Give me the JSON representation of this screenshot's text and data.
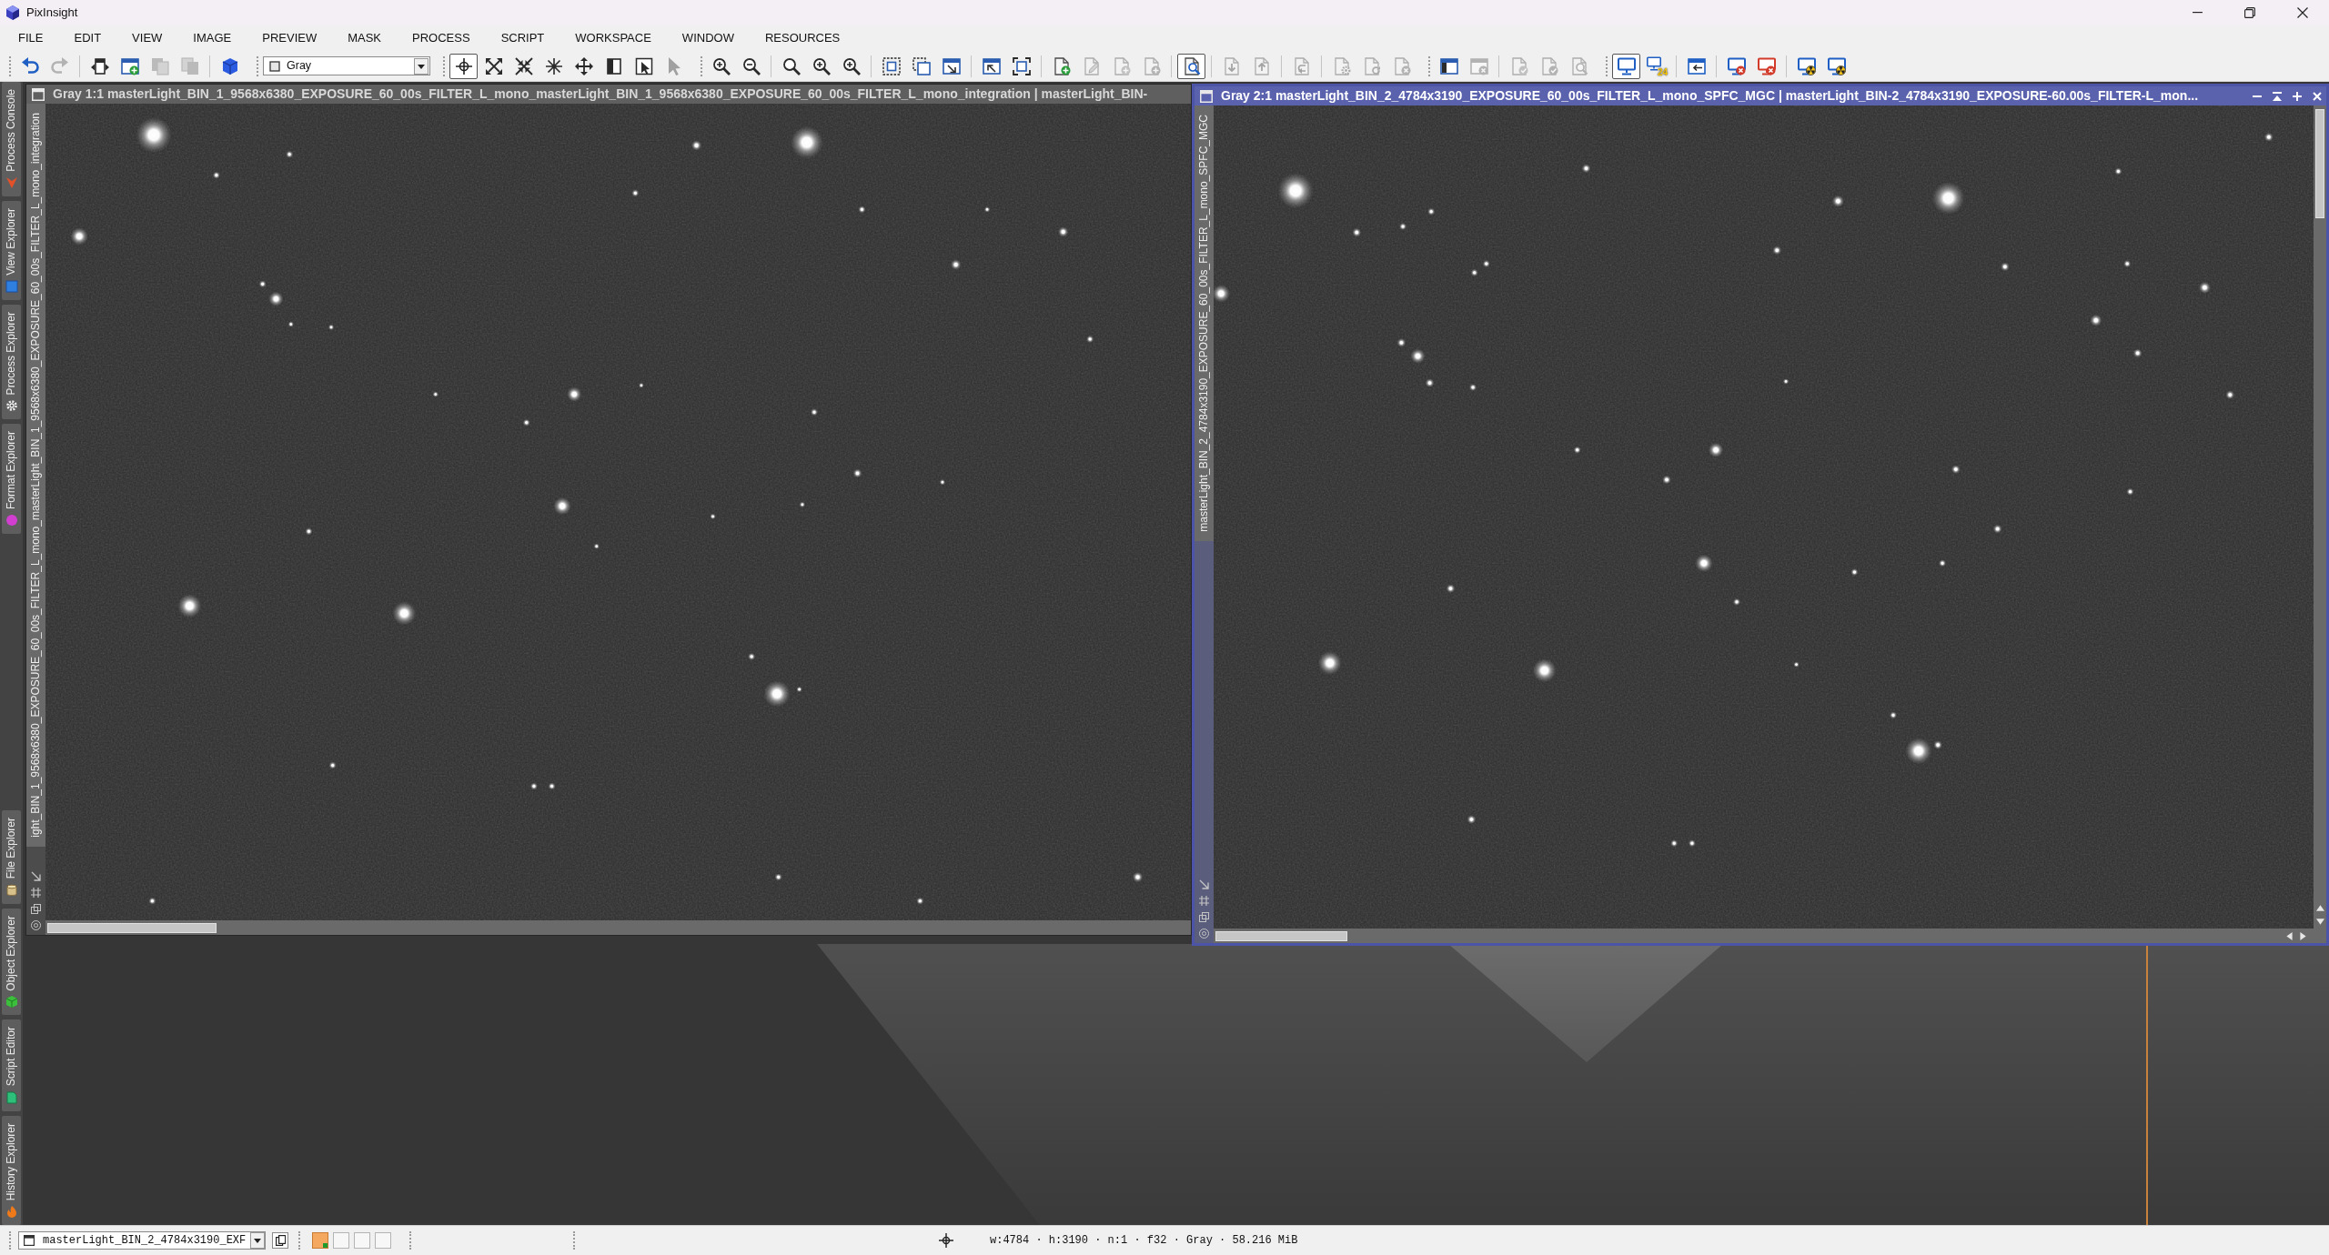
{
  "window": {
    "title": "PixInsight"
  },
  "menu": [
    "FILE",
    "EDIT",
    "VIEW",
    "IMAGE",
    "PREVIEW",
    "MASK",
    "PROCESS",
    "SCRIPT",
    "WORKSPACE",
    "WINDOW",
    "RESOURCES"
  ],
  "toolbars": [
    {
      "kind": "buttons",
      "groups": [
        [
          {
            "selected": false,
            "disabled": false
          },
          {
            "selected": false,
            "disabled": true
          }
        ],
        [
          {
            "selected": false,
            "disabled": false
          },
          {
            "selected": false,
            "disabled": false
          },
          {
            "selected": false,
            "disabled": true
          },
          {
            "selected": false,
            "disabled": true
          }
        ],
        [
          {
            "selected": false,
            "disabled": false
          }
        ]
      ]
    },
    {
      "kind": "combo",
      "value": "Gray"
    },
    {
      "kind": "buttons",
      "groups": [
        [
          {
            "selected": true,
            "disabled": false
          },
          {
            "selected": false,
            "disabled": false
          },
          {
            "selected": false,
            "disabled": false
          },
          {
            "selected": false,
            "disabled": false
          },
          {
            "selected": false,
            "disabled": false
          },
          {
            "selected": false,
            "disabled": false
          },
          {
            "selected": false,
            "disabled": false
          },
          {
            "selected": false,
            "disabled": true
          }
        ]
      ]
    },
    {
      "kind": "buttons",
      "groups": [
        [
          {
            "selected": false,
            "disabled": false
          },
          {
            "selected": false,
            "disabled": false
          }
        ],
        [
          {
            "selected": false,
            "disabled": false
          },
          {
            "selected": false,
            "disabled": false
          },
          {
            "selected": false,
            "disabled": false
          }
        ],
        [
          {
            "selected": false,
            "disabled": false
          },
          {
            "selected": false,
            "disabled": false
          },
          {
            "selected": false,
            "disabled": false
          }
        ],
        [
          {
            "selected": false,
            "disabled": false
          },
          {
            "selected": false,
            "disabled": false
          }
        ],
        [
          {
            "selected": false,
            "disabled": false
          },
          {
            "selected": false,
            "disabled": true
          },
          {
            "selected": false,
            "disabled": true
          },
          {
            "selected": false,
            "disabled": true
          }
        ],
        [
          {
            "selected": true,
            "disabled": false
          }
        ],
        [
          {
            "selected": false,
            "disabled": true
          },
          {
            "selected": false,
            "disabled": true
          }
        ],
        [
          {
            "selected": false,
            "disabled": true
          }
        ],
        [
          {
            "selected": false,
            "disabled": true
          },
          {
            "selected": false,
            "disabled": true
          },
          {
            "selected": false,
            "disabled": true
          }
        ]
      ]
    },
    {
      "kind": "buttons",
      "groups": [
        [
          {
            "selected": false,
            "disabled": false
          },
          {
            "selected": false,
            "disabled": true
          }
        ],
        [
          {
            "selected": false,
            "disabled": true
          },
          {
            "selected": false,
            "disabled": true
          },
          {
            "selected": false,
            "disabled": true
          }
        ]
      ]
    },
    {
      "kind": "buttons",
      "groups": [
        [
          {
            "selected": true,
            "disabled": false
          },
          {
            "selected": false,
            "disabled": false,
            "badge": "24"
          }
        ],
        [
          {
            "selected": false,
            "disabled": false
          }
        ],
        [
          {
            "selected": false,
            "disabled": false
          },
          {
            "selected": false,
            "disabled": false
          }
        ],
        [
          {
            "selected": false,
            "disabled": false
          },
          {
            "selected": false,
            "disabled": false
          }
        ]
      ]
    }
  ],
  "side_panel": {
    "upper_tabs": [
      "Process Console",
      "View Explorer",
      "Process Explorer",
      "Format Explorer"
    ],
    "lower_tabs": [
      "File Explorer",
      "Object Explorer",
      "Script Editor",
      "History Explorer"
    ]
  },
  "image_windows": [
    {
      "title": "Gray 1:1 masterLight_BIN_1_9568x6380_EXPOSURE_60_00s_FILTER_L_mono_masterLight_BIN_1_9568x6380_EXPOSURE_60_00s_FILTER_L_mono_integration | masterLight_BIN-",
      "side_label": "ight_BIN_1_9568x6380_EXPOSURE_60_00s_FILTER_L_mono_masterLight_BIN_1_9568x6380_EXPOSURE_60_00s_FILTER_L_mono_integration",
      "selected": false
    },
    {
      "title": "Gray 2:1 masterLight_BIN_2_4784x3190_EXPOSURE_60_00s_FILTER_L_mono_SPFC_MGC | masterLight_BIN-2_4784x3190_EXPOSURE-60.00s_FILTER-L_mon...",
      "side_label": "masterLight_BIN_2_4784x3190_EXPOSURE_60_00s_FILTER_L_mono_SPFC_MGC",
      "selected": true
    }
  ],
  "status_bar": {
    "view_selector": "masterLight_BIN_2_4784x3190_EXF",
    "swatches": [
      {
        "on": true
      },
      {
        "on": false
      },
      {
        "on": false
      },
      {
        "on": false
      }
    ],
    "info": "w:4784 · h:3190 · n:1 · f32 · Gray · 58.216 MiB"
  }
}
